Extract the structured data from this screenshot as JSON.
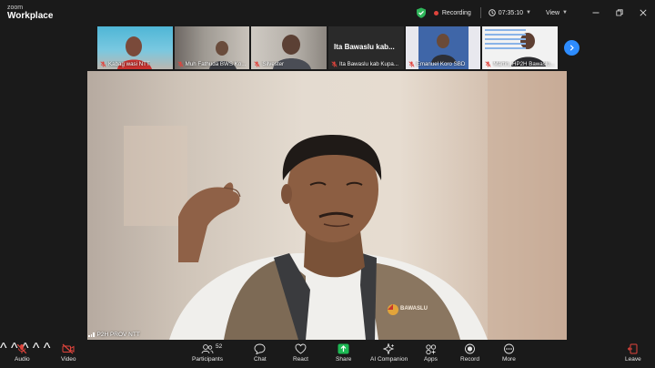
{
  "app": {
    "brand_small": "zoom",
    "brand_big": "Workplace"
  },
  "status": {
    "recording": "Recording",
    "timer": "07:35:10",
    "view": "View"
  },
  "gallery": [
    {
      "name": "Kabag wasi NTT",
      "muted": true
    },
    {
      "name": "Muh Fathuda BWS Ko...",
      "muted": true
    },
    {
      "name": "Silvester",
      "muted": true
    },
    {
      "name": "Ita Bawaslu kab Kupa...",
      "title": "Ita Bawaslu kab...",
      "muted": true
    },
    {
      "name": "Emanuel Koro SBD",
      "muted": true
    },
    {
      "name": "Martin_HP2H Bawaslu...",
      "muted": true
    }
  ],
  "main": {
    "speaker": "P2H PROV NTT",
    "vest_text": "BAWASLU"
  },
  "toolbar": {
    "audio": "Audio",
    "video": "Video",
    "participants": "Participants",
    "participants_count": "52",
    "chat": "Chat",
    "react": "React",
    "share": "Share",
    "ai": "AI Companion",
    "apps": "Apps",
    "record": "Record",
    "more": "More",
    "leave": "Leave"
  },
  "colors": {
    "accent": "#2d8cff",
    "share": "#1db954",
    "danger": "#e0443c",
    "shield": "#2fb55a"
  },
  "icons": [
    "shield-icon",
    "clock-icon",
    "minimize-icon",
    "restore-icon",
    "close-icon",
    "chevron-right-icon",
    "mic-off-icon",
    "video-off-icon",
    "participants-icon",
    "chat-icon",
    "react-icon",
    "share-icon",
    "ai-companion-icon",
    "apps-icon",
    "record-icon",
    "more-icon",
    "leave-icon"
  ]
}
